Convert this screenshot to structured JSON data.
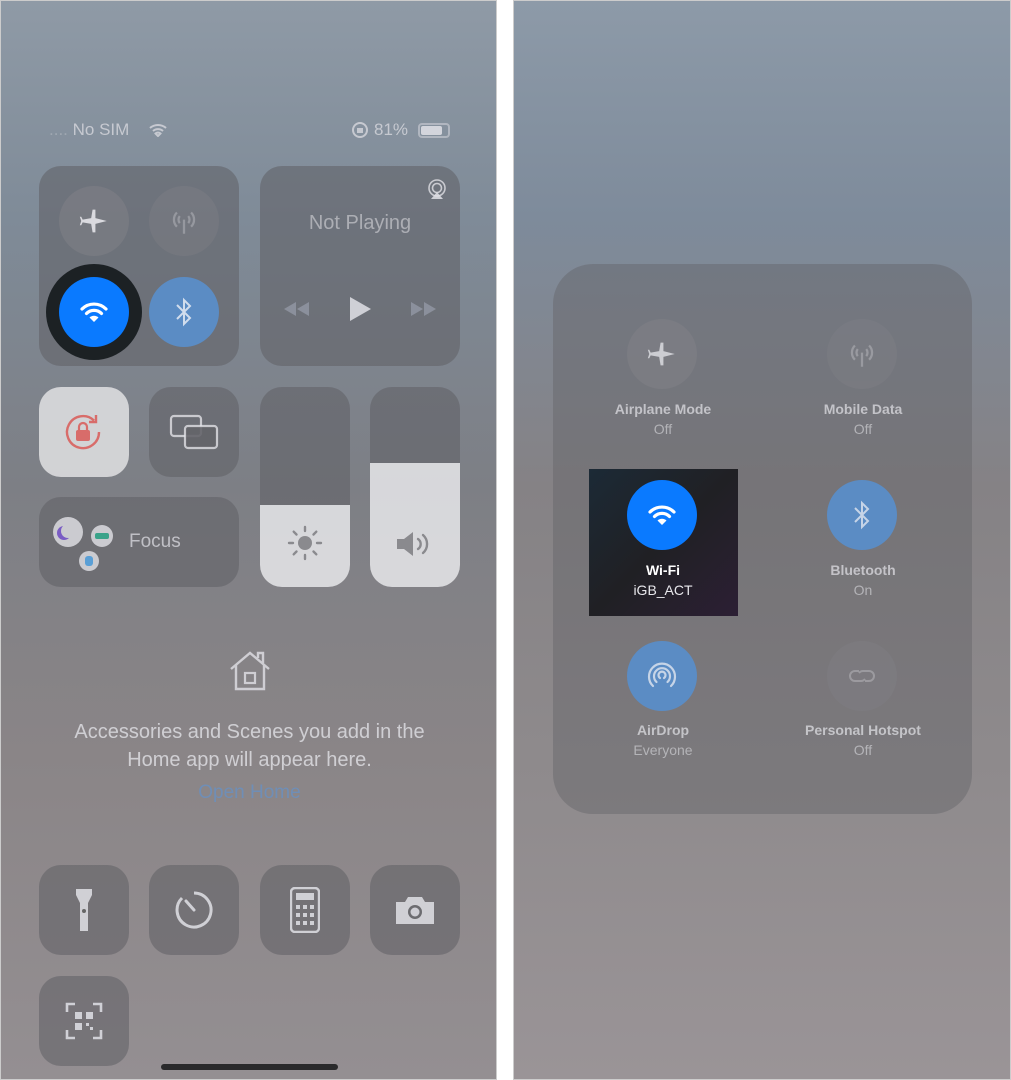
{
  "left": {
    "status": {
      "carrier": "No SIM",
      "battery": "81%"
    },
    "media": {
      "title": "Not Playing"
    },
    "focus": {
      "label": "Focus"
    },
    "home": {
      "message_line1": "Accessories and Scenes you add in the",
      "message_line2": "Home app will appear here.",
      "link": "Open Home"
    },
    "levels": {
      "brightness_percent": 41,
      "volume_percent": 62
    }
  },
  "right": {
    "tiles": [
      {
        "label": "Airplane Mode",
        "status": "Off",
        "icon": "airplane-icon"
      },
      {
        "label": "Mobile Data",
        "status": "Off",
        "icon": "antenna-icon"
      },
      {
        "label": "Wi-Fi",
        "status": "iGB_ACT",
        "icon": "wifi-icon"
      },
      {
        "label": "Bluetooth",
        "status": "On",
        "icon": "bluetooth-icon"
      },
      {
        "label": "AirDrop",
        "status": "Everyone",
        "icon": "airdrop-icon"
      },
      {
        "label": "Personal Hotspot",
        "status": "Off",
        "icon": "hotspot-icon"
      }
    ]
  },
  "colors": {
    "accent": "#0a7aff",
    "active_muted": "#5b8cc4"
  }
}
